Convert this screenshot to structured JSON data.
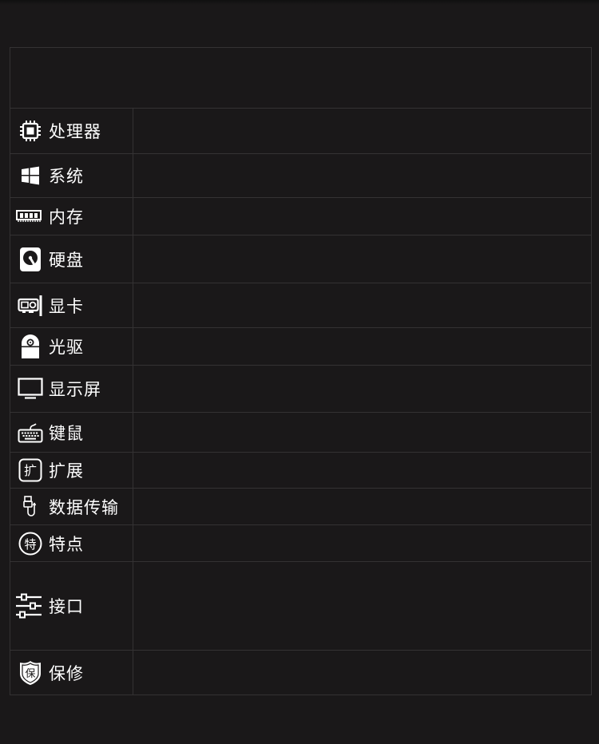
{
  "table": {
    "rows": [
      {
        "icon": "cpu-icon",
        "label": "处理器"
      },
      {
        "icon": "windows-logo-icon",
        "label": "系统"
      },
      {
        "icon": "memory-module-icon",
        "label": "内存"
      },
      {
        "icon": "hard-disk-icon",
        "label": "硬盘"
      },
      {
        "icon": "graphics-card-icon",
        "label": "显卡"
      },
      {
        "icon": "optical-drive-icon",
        "label": "光驱"
      },
      {
        "icon": "monitor-icon",
        "label": "显示屏"
      },
      {
        "icon": "keyboard-icon",
        "label": "键鼠"
      },
      {
        "icon": "expansion-icon",
        "label": "扩展",
        "glyph": "扩"
      },
      {
        "icon": "usb-plug-icon",
        "label": "数据传输"
      },
      {
        "icon": "feature-badge-icon",
        "label": "特点",
        "glyph": "特"
      },
      {
        "icon": "sliders-icon",
        "label": "接口"
      },
      {
        "icon": "warranty-shield-icon",
        "label": "保修",
        "glyph": "保"
      }
    ]
  }
}
